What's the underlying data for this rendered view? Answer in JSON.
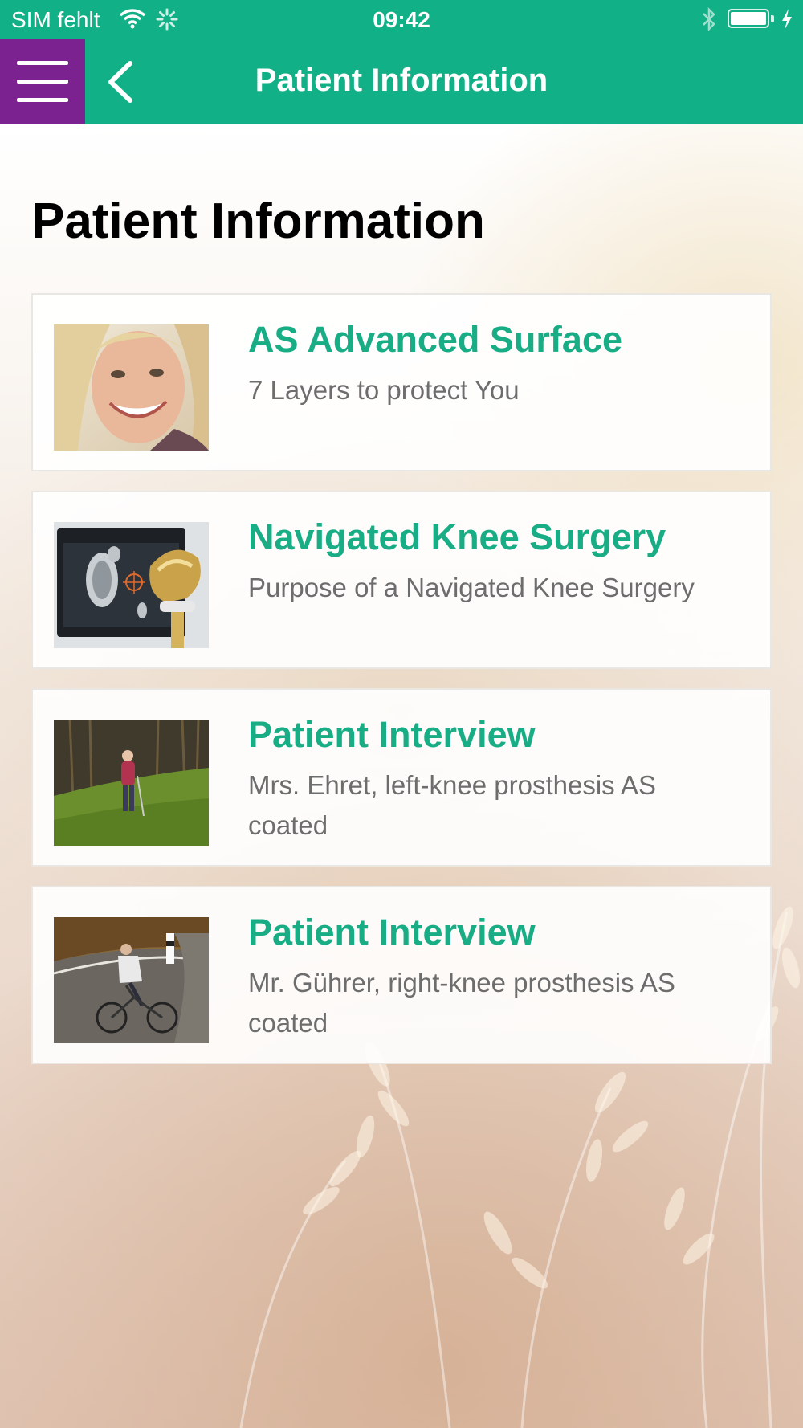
{
  "colors": {
    "brand_green": "#12b086",
    "menu_purple": "#7b2290",
    "item_title": "#18ad84",
    "item_subtitle": "#6d6d6d"
  },
  "status_bar": {
    "carrier": "SIM fehlt",
    "time": "09:42",
    "battery_level": 1.0,
    "icons": [
      "wifi-icon",
      "activity-spinner-icon",
      "bluetooth-icon",
      "battery-icon",
      "charging-icon"
    ]
  },
  "nav": {
    "menu_icon": "hamburger-menu-icon",
    "back_icon": "chevron-left-icon",
    "title": "Patient Information"
  },
  "page": {
    "title": "Patient Information"
  },
  "items": [
    {
      "title": "AS Advanced Surface",
      "subtitle": "7 Layers to protect You",
      "thumbnail": "smiling-woman-photo"
    },
    {
      "title": "Navigated Knee Surgery",
      "subtitle": "Purpose of a Navigated Knee Surgery",
      "thumbnail": "knee-navigation-screen-photo"
    },
    {
      "title": "Patient Interview",
      "subtitle": "Mrs. Ehret, left-knee prosthesis AS coated",
      "thumbnail": "woman-nordic-walking-photo"
    },
    {
      "title": "Patient Interview",
      "subtitle": "Mr. Gührer, right-knee prosthesis AS coated",
      "thumbnail": "man-cycling-photo"
    }
  ]
}
